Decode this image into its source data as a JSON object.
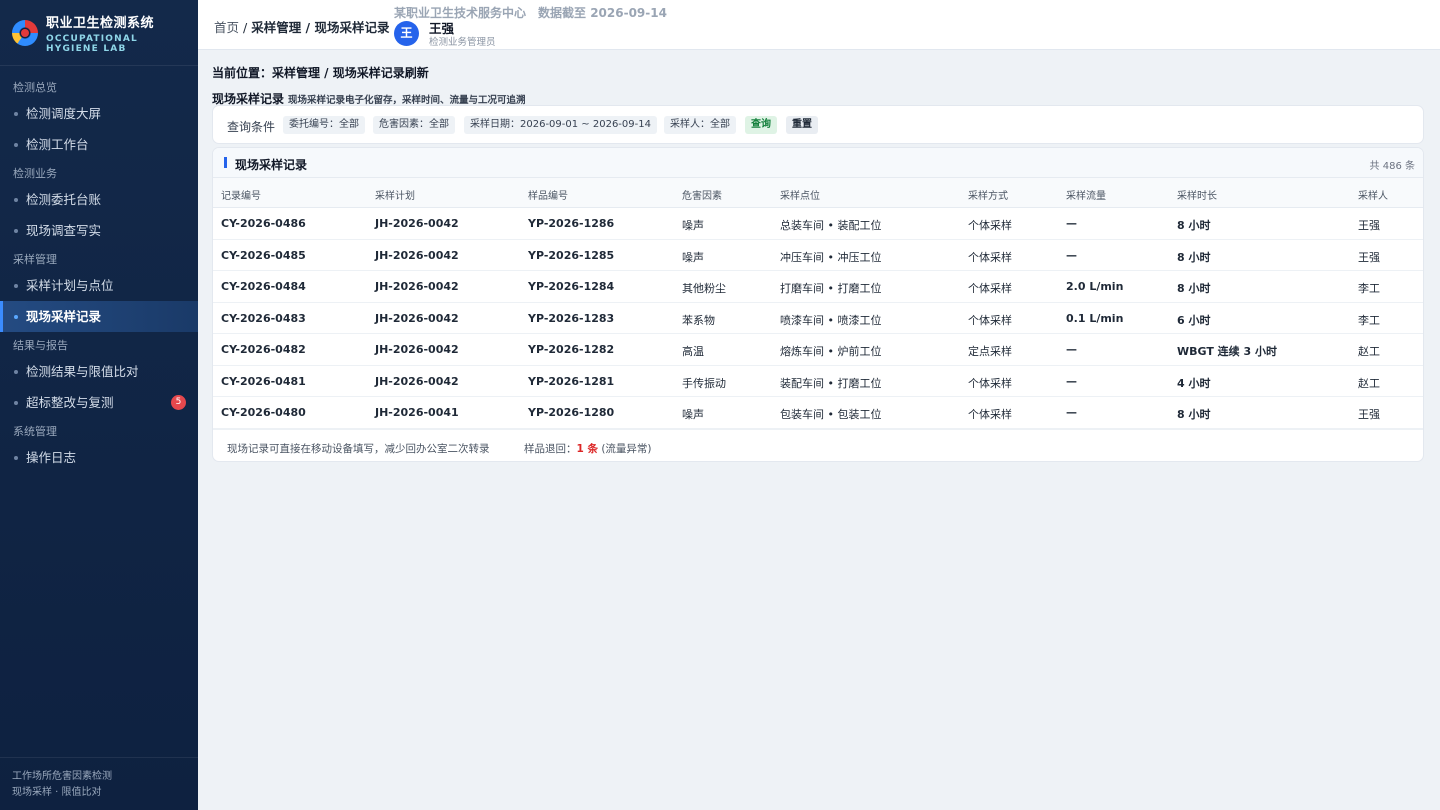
{
  "app": {
    "title": "职业卫生检测系统",
    "subtitle_line1": "OCCUPATIONAL",
    "subtitle_line2": "HYGIENE LAB"
  },
  "sidebar": {
    "groups": [
      {
        "label": "检测总览",
        "items": [
          {
            "label": "检测调度大屏"
          },
          {
            "label": "检测工作台"
          }
        ]
      },
      {
        "label": "检测业务",
        "items": [
          {
            "label": "检测委托台账"
          },
          {
            "label": "现场调查写实"
          }
        ]
      },
      {
        "label": "采样管理",
        "items": [
          {
            "label": "采样计划与点位"
          },
          {
            "label": "现场采样记录"
          }
        ]
      },
      {
        "label": "结果与报告",
        "items": [
          {
            "label": "检测结果与限值比对"
          },
          {
            "label": "超标整改与复测",
            "badge": "5"
          }
        ]
      },
      {
        "label": "系统管理",
        "items": [
          {
            "label": "操作日志"
          }
        ]
      }
    ],
    "footer_line1": "工作场所危害因素检测",
    "footer_line2": "现场采样 · 限值比对"
  },
  "header": {
    "crumb_home": "首页",
    "crumb_sep": " / ",
    "crumb_path": "采样管理 / 现场采样记录",
    "org_name": "某职业卫生技术服务中心",
    "data_date": "数据截至 2026-09-14",
    "avatar_initial": "王",
    "user_name": "王强",
    "user_role": "检测业务管理员"
  },
  "main": {
    "location": "当前位置：采样管理 / 现场采样记录刷新",
    "section_title": "现场采样记录",
    "section_desc": "现场采样记录电子化留存，采样时间、流量与工况可追溯",
    "filter": {
      "label": "查询条件",
      "chips": [
        "委托编号：全部",
        "危害因素：全部",
        "采样日期：2026-09-01 ~ 2026-09-14",
        "采样人：全部"
      ],
      "query_btn": "查询",
      "reset_btn": "重置"
    },
    "table": {
      "title": "现场采样记录",
      "count": "共 486 条",
      "columns": [
        "记录编号",
        "采样计划",
        "样品编号",
        "危害因素",
        "采样点位",
        "采样方式",
        "采样流量",
        "采样时长",
        "采样人"
      ],
      "rows": [
        [
          "CY-2026-0486",
          "JH-2026-0042",
          "YP-2026-1286",
          "噪声",
          "总装车间 • 装配工位",
          "个体采样",
          "—",
          "8 小时",
          "王强"
        ],
        [
          "CY-2026-0485",
          "JH-2026-0042",
          "YP-2026-1285",
          "噪声",
          "冲压车间 • 冲压工位",
          "个体采样",
          "—",
          "8 小时",
          "王强"
        ],
        [
          "CY-2026-0484",
          "JH-2026-0042",
          "YP-2026-1284",
          "其他粉尘",
          "打磨车间 • 打磨工位",
          "个体采样",
          "2.0 L/min",
          "8 小时",
          "李工"
        ],
        [
          "CY-2026-0483",
          "JH-2026-0042",
          "YP-2026-1283",
          "苯系物",
          "喷漆车间 • 喷漆工位",
          "个体采样",
          "0.1 L/min",
          "6 小时",
          "李工"
        ],
        [
          "CY-2026-0482",
          "JH-2026-0042",
          "YP-2026-1282",
          "高温",
          "熔炼车间 • 炉前工位",
          "定点采样",
          "—",
          "WBGT 连续 3 小时",
          "赵工"
        ],
        [
          "CY-2026-0481",
          "JH-2026-0042",
          "YP-2026-1281",
          "手传振动",
          "装配车间 • 打磨工位",
          "个体采样",
          "—",
          "4 小时",
          "赵工"
        ],
        [
          "CY-2026-0480",
          "JH-2026-0041",
          "YP-2026-1280",
          "噪声",
          "包装车间 • 包装工位",
          "个体采样",
          "—",
          "8 小时",
          "王强"
        ]
      ],
      "footer_note": "现场记录可直接在移动设备填写，减少回办公室二次转录",
      "return_label": "样品退回：",
      "return_count": "1 条",
      "return_reason": "(流量异常)"
    }
  }
}
